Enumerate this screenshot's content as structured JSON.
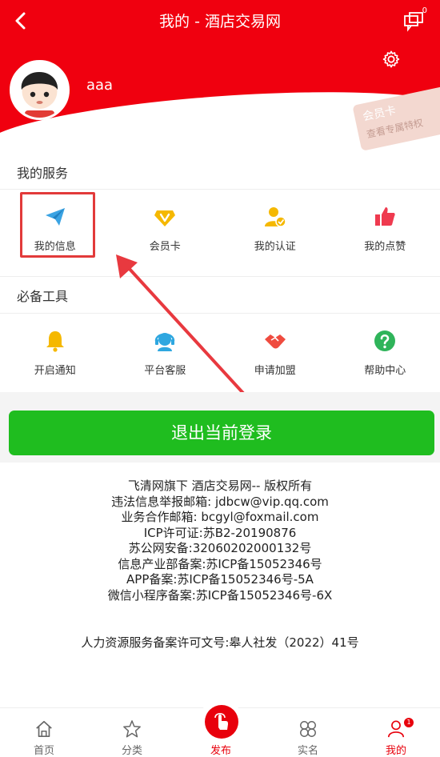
{
  "header": {
    "title": "我的 - 酒店交易网",
    "message_badge": "0",
    "username": "aaa",
    "vip_card": {
      "label": "会员卡",
      "subtitle": "查看专属特权"
    }
  },
  "services": {
    "title": "我的服务",
    "items": [
      {
        "label": "我的信息",
        "icon": "paper-plane-icon",
        "color": "#3aa3e3"
      },
      {
        "label": "会员卡",
        "icon": "vip-diamond-icon",
        "color": "#f5b800"
      },
      {
        "label": "我的认证",
        "icon": "verified-user-icon",
        "color": "#f5b800"
      },
      {
        "label": "我的点赞",
        "icon": "thumbs-up-icon",
        "color": "#ef3a4f"
      }
    ]
  },
  "tools": {
    "title": "必备工具",
    "items": [
      {
        "label": "开启通知",
        "icon": "bell-icon",
        "color": "#f5b800"
      },
      {
        "label": "平台客服",
        "icon": "headset-icon",
        "color": "#2ea7e0"
      },
      {
        "label": "申请加盟",
        "icon": "handshake-icon",
        "color": "#ef4b3f"
      },
      {
        "label": "帮助中心",
        "icon": "help-icon",
        "color": "#2fb45a"
      }
    ]
  },
  "logout_label": "退出当前登录",
  "footer": {
    "lines": [
      "飞清网旗下 酒店交易网-- 版权所有",
      "违法信息举报邮箱: jdbcw@vip.qq.com",
      "业务合作邮箱: bcgyl@foxmail.com",
      "ICP许可证:苏B2-20190876",
      "苏公网安备:32060202000132号",
      "信息产业部备案:苏ICP备15052346号",
      "APP备案:苏ICP备15052346号-5A",
      "微信小程序备案:苏ICP备15052346号-6X"
    ],
    "hr_license": "人力资源服务备案许可文号:皋人社发（2022）41号"
  },
  "tabbar": {
    "items": [
      {
        "label": "首页",
        "icon": "home-icon"
      },
      {
        "label": "分类",
        "icon": "star-icon"
      },
      {
        "label": "发布",
        "icon": "publish-icon"
      },
      {
        "label": "实名",
        "icon": "grid-icon"
      },
      {
        "label": "我的",
        "icon": "user-icon"
      }
    ],
    "active_index": 4,
    "mine_badge": "1"
  },
  "colors": {
    "brand_red": "#f0000f",
    "logout_green": "#1fbd1f"
  }
}
